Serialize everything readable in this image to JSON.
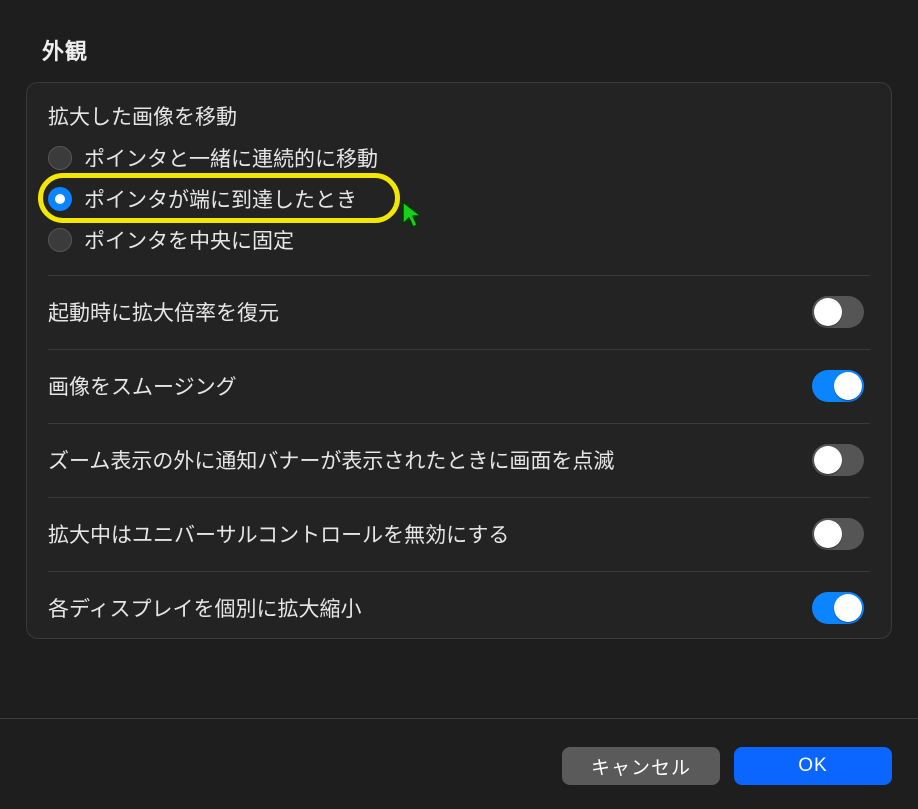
{
  "section_title": "外観",
  "radio_group": {
    "label": "拡大した画像を移動",
    "options": [
      {
        "label": "ポインタと一緒に連続的に移動",
        "selected": false
      },
      {
        "label": "ポインタが端に到達したとき",
        "selected": true
      },
      {
        "label": "ポインタを中央に固定",
        "selected": false
      }
    ]
  },
  "toggles": [
    {
      "label": "起動時に拡大倍率を復元",
      "on": false
    },
    {
      "label": "画像をスムージング",
      "on": true
    },
    {
      "label": "ズーム表示の外に通知バナーが表示されたときに画面を点滅",
      "on": false
    },
    {
      "label": "拡大中はユニバーサルコントロールを無効にする",
      "on": false
    },
    {
      "label": "各ディスプレイを個別に拡大縮小",
      "on": true
    }
  ],
  "buttons": {
    "cancel": "キャンセル",
    "ok": "OK"
  },
  "colors": {
    "accent": "#0a84ff",
    "highlight": "#f3e600",
    "bg": "#1e1e1e",
    "panel": "#232323"
  }
}
